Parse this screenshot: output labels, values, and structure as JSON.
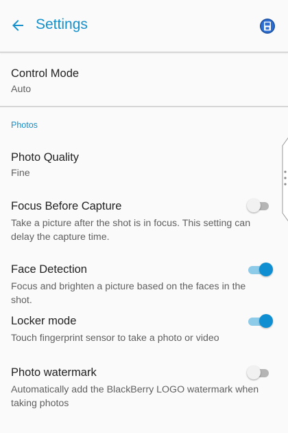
{
  "header": {
    "title": "Settings",
    "back_icon": "arrow-left-icon",
    "save_icon": "floppy-disk-icon",
    "accent_color": "#1490cc"
  },
  "control_mode": {
    "label": "Control Mode",
    "value": "Auto"
  },
  "photos_section": {
    "header": "Photos"
  },
  "settings": {
    "photo_quality": {
      "label": "Photo Quality",
      "value": "Fine"
    },
    "focus_before_capture": {
      "label": "Focus Before Capture",
      "description": "Take a picture after the shot is in focus. This setting can delay the capture time.",
      "enabled": false
    },
    "face_detection": {
      "label": "Face Detection",
      "description": "Focus and brighten a picture based on the faces in the shot.",
      "enabled": true
    },
    "locker_mode": {
      "label": "Locker mode",
      "description": "Touch fingerprint sensor to take a photo or video",
      "enabled": true
    },
    "photo_watermark": {
      "label": "Photo watermark",
      "description": "Automatically add the BlackBerry LOGO watermark when taking photos",
      "enabled": false
    }
  },
  "colors": {
    "switch_on": "#0f8ed1",
    "switch_on_track": "#8ecbe9",
    "switch_off_track": "#b5b5b5"
  }
}
